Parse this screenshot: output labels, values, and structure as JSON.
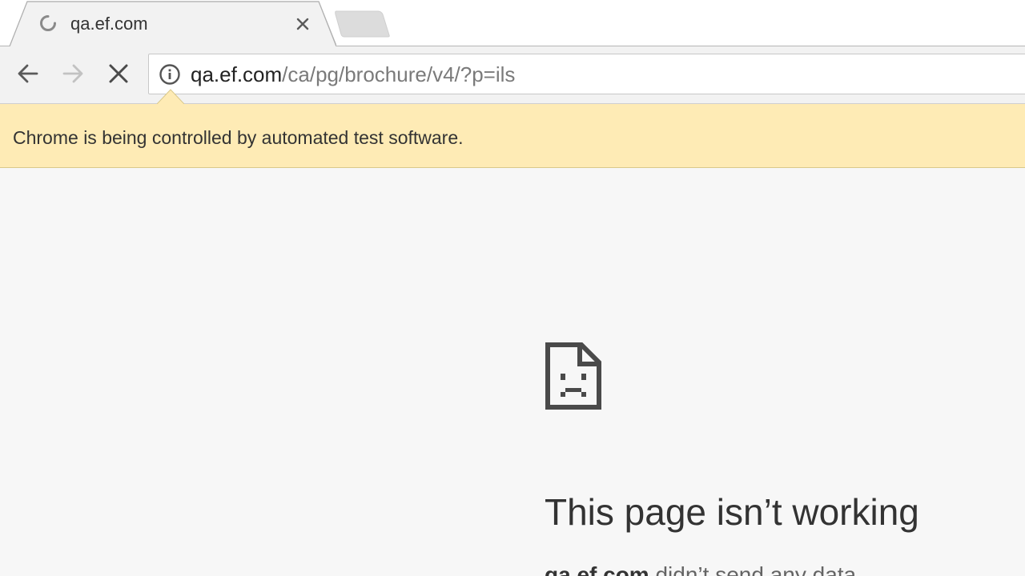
{
  "tab": {
    "title": "qa.ef.com",
    "loading": true
  },
  "toolbar": {
    "url_host": "qa.ef.com",
    "url_path": "/ca/pg/brochure/v4/?p=ils"
  },
  "infobar": {
    "message": "Chrome is being controlled by automated test software."
  },
  "error_page": {
    "title": "This page isn’t working",
    "detail_host": "qa.ef.com",
    "detail_text": " didn’t send any data."
  },
  "icons": {
    "tab_spinner": "loading-spinner-icon",
    "tab_close": "close-icon",
    "back": "arrow-back-icon",
    "forward": "arrow-forward-icon",
    "stop": "stop-icon",
    "site_info": "info-icon",
    "error": "sad-document-icon"
  },
  "colors": {
    "infobar_bg": "#feebb5",
    "page_bg": "#f7f7f7",
    "toolbar_bg": "#f2f2f2"
  }
}
